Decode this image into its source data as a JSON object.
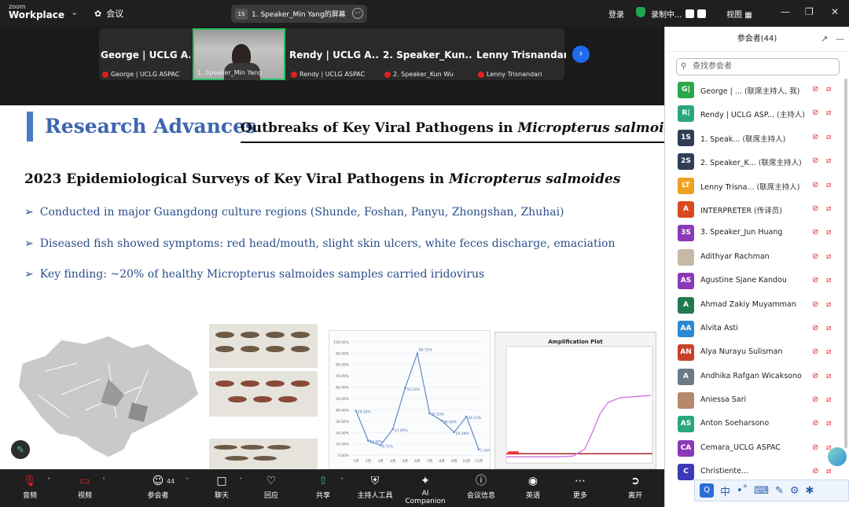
{
  "app": {
    "logo_line1": "zoom",
    "logo_line2": "Workplace",
    "meeting_label": "会议",
    "share_badge": "1S",
    "share_title": "1. Speaker_Min Yang的屏幕",
    "login": "登录",
    "recording": "录制中...",
    "view": "视图"
  },
  "speakers": [
    {
      "name": "George | UCLG A...",
      "sub": "George | UCLG ASPAC"
    },
    {
      "name": "",
      "sub": "1. Speaker_Min Yang"
    },
    {
      "name": "Rendy | UCLG A...",
      "sub": "Rendy | UCLG ASPAC"
    },
    {
      "name": "2. Speaker_Kun...",
      "sub": "2. Speaker_Kun Wu"
    },
    {
      "name": "Lenny Trisnandari",
      "sub": "Lenny Trisnandari"
    }
  ],
  "slide": {
    "title": "Research Advances",
    "subtitle_prefix": "Outbreaks of Key Viral Pathogens in ",
    "subtitle_italic": "Micropterus salmoides",
    "heading_prefix": "2023 Epidemiological Surveys of Key Viral Pathogens in ",
    "heading_italic": "Micropterus salmoides",
    "bullets": [
      "Conducted in major Guangdong culture regions (Shunde, Foshan, Panyu, Zhongshan, Zhuhai)",
      "Diseased fish showed symptoms: red head/mouth, slight skin ulcers, white feces discharge, emaciation",
      "Key finding: ~20% of healthy Micropterus salmoides samples carried iridovirus"
    ],
    "amp_title": "Amplification Plot"
  },
  "chart_data": {
    "type": "line",
    "categories": [
      "1月",
      "2月",
      "3月",
      "4月",
      "5月",
      "6月",
      "7月",
      "8月",
      "9月",
      "10月",
      "11月"
    ],
    "values": [
      39.2,
      12.9,
      8.72,
      23.0,
      59.16,
      89.72,
      37.05,
      30.4,
      20.28,
      34.15,
      5.26
    ],
    "data_labels": [
      "39.20%",
      "12.90%",
      "8.72%",
      "23.00%",
      "59.16%",
      "89.72%",
      "37.05%",
      "30.40%",
      "20.28%",
      "34.15%",
      "5.26%"
    ],
    "yticks": [
      "0.00%",
      "10.00%",
      "20.00%",
      "30.00%",
      "40.00%",
      "50.00%",
      "60.00%",
      "70.00%",
      "80.00%",
      "90.00%",
      "100.00%"
    ],
    "ylim": [
      0,
      100
    ],
    "color": "#6b8fc9"
  },
  "toolbar": [
    {
      "label": "音频",
      "icon": "mic-off-icon"
    },
    {
      "label": "视频",
      "icon": "video-off-icon"
    },
    {
      "label": "参会者",
      "icon": "people-icon",
      "count": "44"
    },
    {
      "label": "聊天",
      "icon": "chat-icon"
    },
    {
      "label": "回应",
      "icon": "heart-icon"
    },
    {
      "label": "共享",
      "icon": "share-icon"
    },
    {
      "label": "主持人工具",
      "icon": "shield-icon"
    },
    {
      "label": "AI Companion",
      "icon": "sparkle-icon"
    },
    {
      "label": "会议信息",
      "icon": "info-icon"
    },
    {
      "label": "英语",
      "icon": "language-icon"
    },
    {
      "label": "更多",
      "icon": "more-icon"
    },
    {
      "label": "离开",
      "icon": "leave-icon"
    }
  ],
  "panel": {
    "title": "参会者(44)",
    "search_placeholder": "查找参会者",
    "participants": [
      {
        "initials": "G|",
        "color": "#2aa84a",
        "name": "George | ...",
        "role": "(联席主持人, 我)"
      },
      {
        "initials": "R|",
        "color": "#2aa87a",
        "name": "Rendy | UCLG ASP...",
        "role": "(主持人)"
      },
      {
        "initials": "1S",
        "color": "#2d3f55",
        "name": "1. Speak...",
        "role": "(联席主持人)"
      },
      {
        "initials": "2S",
        "color": "#2d3f55",
        "name": "2. Speaker_K...",
        "role": "(联席主持人)"
      },
      {
        "initials": "LT",
        "color": "#f0a020",
        "name": "Lenny Trisna...",
        "role": "(联席主持人)"
      },
      {
        "initials": "A",
        "color": "#d84a20",
        "name": "INTERPRETER",
        "role": "(传译员)"
      },
      {
        "initials": "3S",
        "color": "#8a3ab8",
        "name": "3. Speaker_Jun Huang",
        "role": ""
      },
      {
        "initials": "",
        "color": "#c9b8a6",
        "name": "Adithyar Rachman",
        "role": ""
      },
      {
        "initials": "AS",
        "color": "#8a3ab8",
        "name": "Agustine Sjane Kandou",
        "role": ""
      },
      {
        "initials": "A",
        "color": "#1f7a50",
        "name": "Ahmad Zakiy Muyamman",
        "role": ""
      },
      {
        "initials": "AA",
        "color": "#2a8ad6",
        "name": "Alvita Asti",
        "role": ""
      },
      {
        "initials": "AN",
        "color": "#c8402a",
        "name": "Alya Nurayu Sulisman",
        "role": ""
      },
      {
        "initials": "A",
        "color": "#6a7a88",
        "name": "Andhika Rafgan Wicaksono",
        "role": ""
      },
      {
        "initials": "",
        "color": "#b48a6a",
        "name": "Aniessa Sari",
        "role": ""
      },
      {
        "initials": "AS",
        "color": "#2aa87a",
        "name": "Anton Soeharsono",
        "role": ""
      },
      {
        "initials": "CA",
        "color": "#8a3ab8",
        "name": "Cemara_UCLG ASPAC",
        "role": ""
      },
      {
        "initials": "C",
        "color": "#3a3ab8",
        "name": "Christiente...",
        "role": ""
      }
    ]
  },
  "ime": {
    "q": "Q",
    "lang": "中"
  }
}
